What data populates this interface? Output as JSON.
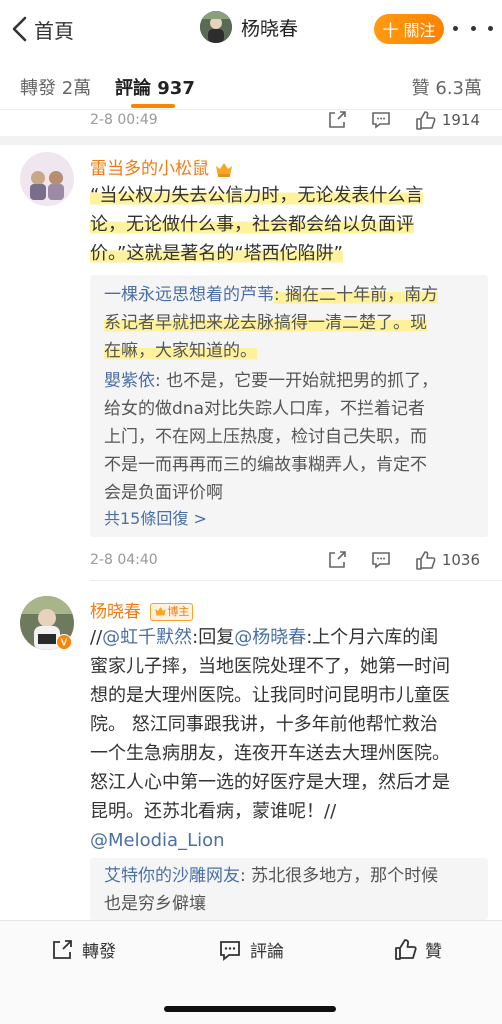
{
  "nav": {
    "back_label": "首頁",
    "profile_name": "杨晓春",
    "follow_label": "十 關注"
  },
  "tabs": {
    "repost": "轉發 2萬",
    "comment": "評論 937",
    "like": "贊 6.3萬"
  },
  "prev_comment_meta": {
    "time": "2-8 00:49",
    "likes": "1914"
  },
  "comment1": {
    "username": "雷当多的小松鼠",
    "lines": [
      "“当公权力失去公信力时，无论发表什么言",
      "论，无论做什么事，社会都会给以负面评",
      "价。”这就是著名的“塔西佗陷阱”"
    ],
    "replies": [
      {
        "name": "一棵永远思想着的芦苇",
        "lines": [
          ": 搁在二十年前，南方",
          "系记者早就把来龙去脉搞得一清二楚了。现",
          "在嘛，大家知道的。"
        ]
      },
      {
        "name": "嬰紫依",
        "lines": [
          ": 也不是，它要一开始就把男的抓了，",
          "给女的做dna对比失踪人口库，不拦着记者",
          "上门，不在网上压热度，检讨自己失职，而",
          "不是一而再再而三的编故事糊弄人，肯定不",
          "会是负面评价啊"
        ]
      }
    ],
    "more_replies": "共15條回復 >",
    "time": "2-8 04:40",
    "likes": "1036"
  },
  "comment2": {
    "username": "杨晓春",
    "badge": "博主",
    "segments": {
      "l1a": "//",
      "l1b": "@虹千默然",
      "l1c": ":回复",
      "l1d": "@杨晓春",
      "l1e": ":上个月六库的闺"
    },
    "lines": [
      "蜜家儿子摔，当地医院处理不了，她第一时间",
      "想的是大理州医院。让我同时问昆明市儿童医",
      "院。 怒江同事跟我讲，十多年前他帮忙救治",
      "一个生急病朋友，连夜开车送去大理州医院。",
      "怒江人心中第一选的好医疗是大理，然后才是",
      "昆明。还苏北看病，蒙谁呢！//"
    ],
    "last_link": "@Melodia_Lion",
    "reply": {
      "name": "艾特你的沙雕网友",
      "lines": [
        ": 苏北很多地方，那个时候",
        "也是穷乡僻壤"
      ]
    }
  },
  "bottom": {
    "repost": "轉發",
    "comment": "評論",
    "like": "贊"
  }
}
